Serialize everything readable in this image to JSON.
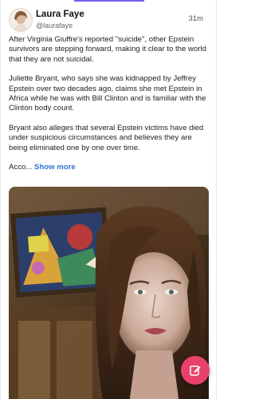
{
  "post": {
    "author_name": "Laura Faye",
    "author_handle": "@laurafaye",
    "time": "31m",
    "paragraphs": [
      "After Virginia Giuffre's reported \"suicide\", other Epstein survivors are stepping forward, making it clear to the world that they are not suicidal.",
      "Juliette Bryant, who says she was kidnapped by Jeffrey Epstein over two decades ago, claims she met Epstein in Africa while he was with Bill Clinton and is familiar with the Clinton body count.",
      "Bryant also alleges that several Epstein victims have died under suspicious circumstances and believes they are being eliminated one by one over time."
    ],
    "truncated_text": "Acco...",
    "show_more_label": "Show more"
  },
  "colors": {
    "accent": "#7a5cf0",
    "link": "#2f74d8",
    "fab": "#e8426b"
  },
  "icons": {
    "fab": "pencil-edit-icon"
  }
}
